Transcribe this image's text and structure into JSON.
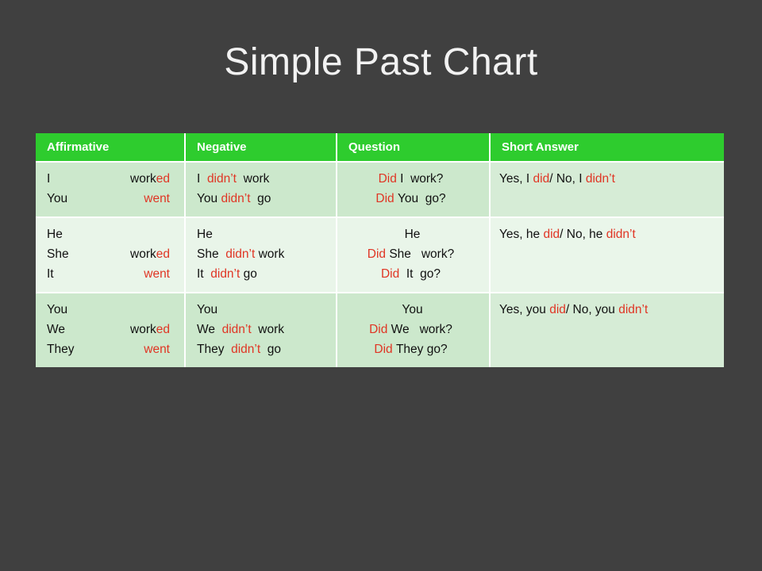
{
  "slide": {
    "title": "Simple Past Chart",
    "background_color": "#404040",
    "title_color": "#f2f2f2"
  },
  "colors": {
    "header_green": "#2ECC2E",
    "row_dark": "#cce8cc",
    "row_light": "#e9f5e9",
    "accent_red": "#e03524",
    "text_black": "#111111"
  },
  "table": {
    "headers": [
      "Affirmative",
      "Negative",
      "Question",
      "Short Answer"
    ],
    "rows": [
      {
        "shade": "dark",
        "affirmative": {
          "lines": [
            {
              "pronoun": "I",
              "verb_black": "work",
              "verb_red": "ed"
            },
            {
              "pronoun": "You",
              "verb_black": "",
              "verb_red": "went"
            }
          ]
        },
        "negative": {
          "lines": [
            {
              "pronoun": "I",
              "aux": "didn’t",
              "verb": "work"
            },
            {
              "pronoun": "You",
              "aux": "didn’t",
              "verb": "go"
            }
          ]
        },
        "question": {
          "lines": [
            {
              "aux": "Did",
              "pronoun": "I",
              "verb": "work?"
            },
            {
              "aux": "Did",
              "pronoun": "You",
              "verb": "go?"
            }
          ]
        },
        "short_answer": {
          "yes_prefix": "Yes, I ",
          "yes_red": "did",
          "middle": "/ No, I ",
          "no_red": "didn’t"
        }
      },
      {
        "shade": "light",
        "affirmative": {
          "lines": [
            {
              "pronoun": "He",
              "verb_black": "",
              "verb_red": ""
            },
            {
              "pronoun": "She",
              "verb_black": "work",
              "verb_red": "ed"
            },
            {
              "pronoun": "It",
              "verb_black": "",
              "verb_red": "went"
            }
          ]
        },
        "negative": {
          "lines": [
            {
              "pronoun": "He",
              "aux": "",
              "verb": ""
            },
            {
              "pronoun": "She",
              "aux": "didn’t",
              "verb": "work"
            },
            {
              "pronoun": "It",
              "aux": "didn’t",
              "verb": "go"
            }
          ]
        },
        "question": {
          "lines": [
            {
              "aux": "",
              "pronoun": "He",
              "verb": ""
            },
            {
              "aux": "Did",
              "pronoun": "She",
              "verb": "work?"
            },
            {
              "aux": "Did",
              "pronoun": "It",
              "verb": "go?"
            }
          ]
        },
        "short_answer": {
          "yes_prefix": "Yes, he ",
          "yes_red": "did",
          "middle": "/ No, he ",
          "no_red": "didn’t"
        }
      },
      {
        "shade": "dark",
        "affirmative": {
          "lines": [
            {
              "pronoun": "You",
              "verb_black": "",
              "verb_red": ""
            },
            {
              "pronoun": "We",
              "verb_black": "work",
              "verb_red": "ed"
            },
            {
              "pronoun": "They",
              "verb_black": "",
              "verb_red": "went"
            }
          ]
        },
        "negative": {
          "lines": [
            {
              "pronoun": "You",
              "aux": "",
              "verb": ""
            },
            {
              "pronoun": "We",
              "aux": "didn’t",
              "verb": "work"
            },
            {
              "pronoun": "They",
              "aux": "didn’t",
              "verb": "go"
            }
          ]
        },
        "question": {
          "lines": [
            {
              "aux": "",
              "pronoun": "You",
              "verb": ""
            },
            {
              "aux": "Did",
              "pronoun": "We",
              "verb": "work?"
            },
            {
              "aux": "Did",
              "pronoun": "They",
              "verb": "go?"
            }
          ]
        },
        "short_answer": {
          "yes_prefix": "Yes, you ",
          "yes_red": "did",
          "middle": "/ No, you ",
          "no_red": "didn’t"
        }
      }
    ]
  }
}
